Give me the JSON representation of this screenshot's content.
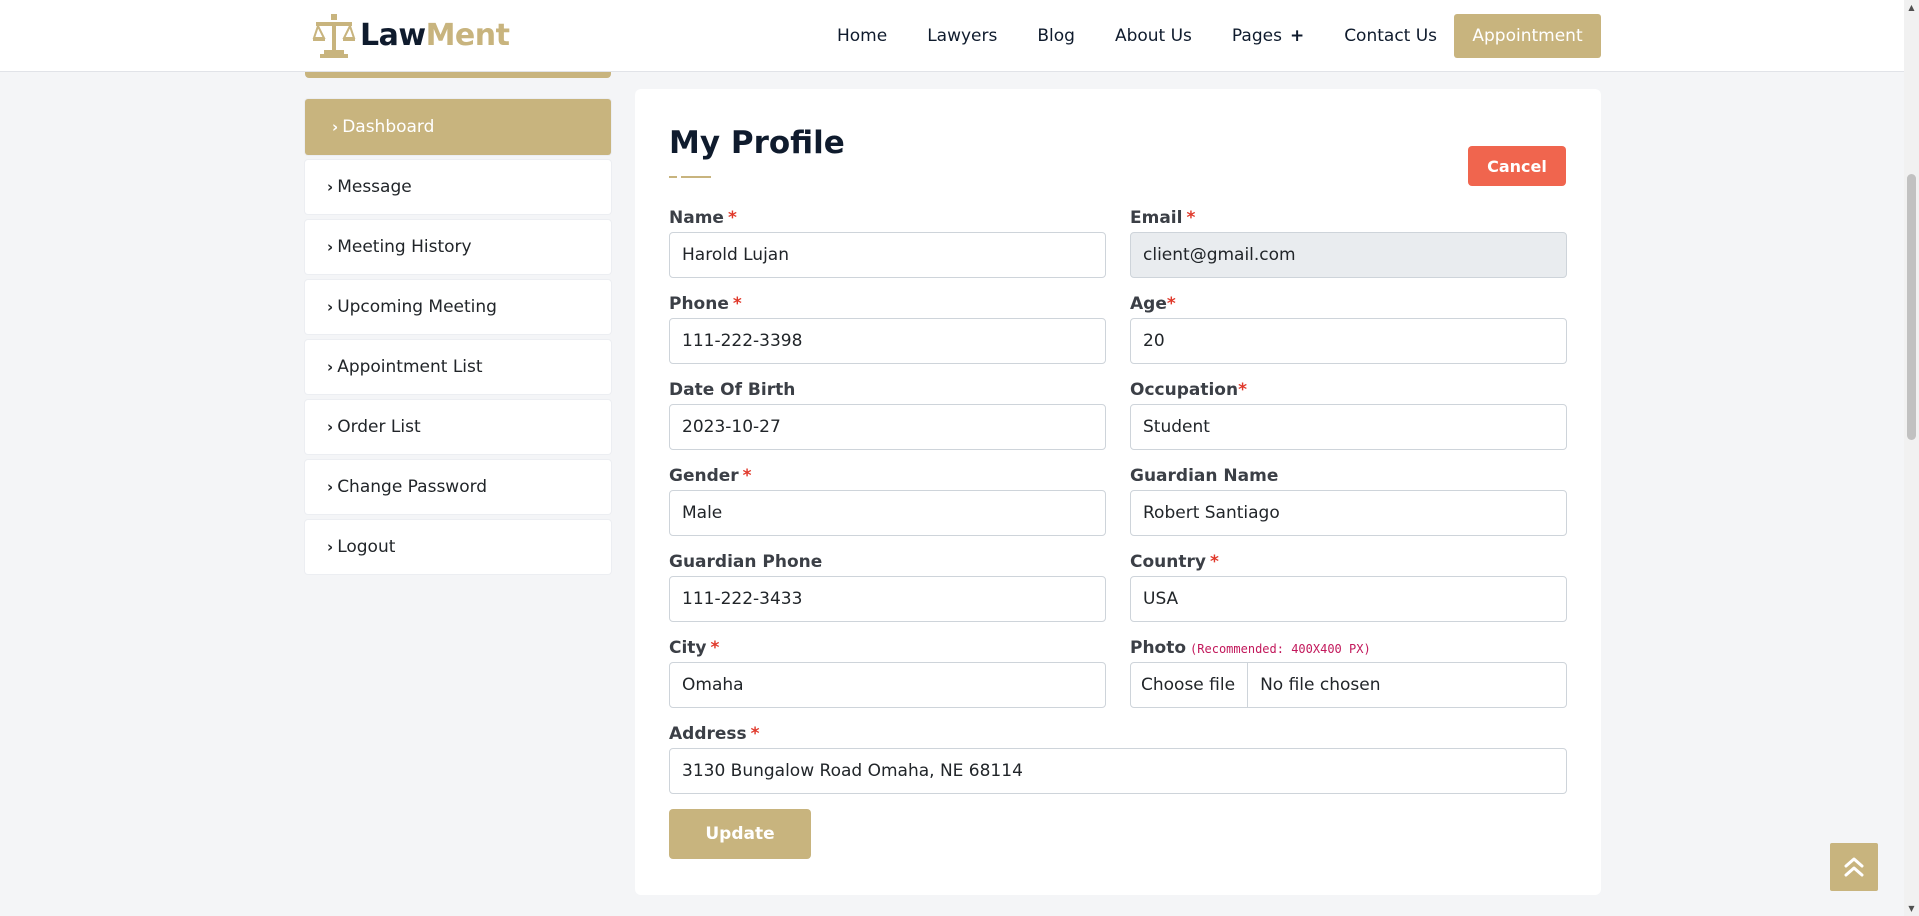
{
  "header": {
    "logo": {
      "part1": "Law",
      "part2": "Ment"
    },
    "nav": [
      {
        "label": "Home"
      },
      {
        "label": "Lawyers"
      },
      {
        "label": "Blog"
      },
      {
        "label": "About Us"
      },
      {
        "label": "Pages",
        "has_submenu": true,
        "submenu_icon": "+"
      },
      {
        "label": "Contact Us"
      }
    ],
    "appointment_label": "Appointment"
  },
  "sidebar": {
    "items": [
      {
        "label": "Dashboard",
        "active": true
      },
      {
        "label": "Message"
      },
      {
        "label": "Meeting History"
      },
      {
        "label": "Upcoming Meeting"
      },
      {
        "label": "Appointment List"
      },
      {
        "label": "Order List"
      },
      {
        "label": "Change Password"
      },
      {
        "label": "Logout"
      }
    ]
  },
  "profile": {
    "title": "My Profile",
    "cancel_label": "Cancel",
    "required_mark": "*",
    "fields": {
      "name": {
        "label": "Name",
        "value": "Harold Lujan"
      },
      "email": {
        "label": "Email",
        "value": "client@gmail.com",
        "disabled": true
      },
      "phone": {
        "label": "Phone",
        "value": "111-222-3398"
      },
      "age": {
        "label": "Age",
        "value": "20"
      },
      "dob": {
        "label": "Date Of Birth",
        "value": "2023-10-27"
      },
      "occupation": {
        "label": "Occupation",
        "value": "Student"
      },
      "gender": {
        "label": "Gender",
        "value": "Male"
      },
      "guardian_name": {
        "label": "Guardian Name",
        "value": "Robert Santiago"
      },
      "guardian_phone": {
        "label": "Guardian Phone",
        "value": "111-222-3433"
      },
      "country": {
        "label": "Country",
        "value": "USA"
      },
      "city": {
        "label": "City",
        "value": "Omaha"
      },
      "photo": {
        "label": "Photo",
        "hint": "(Recommended: 400X400 PX)",
        "button": "Choose file",
        "status": "No file chosen"
      },
      "address": {
        "label": "Address",
        "value": "3130 Bungalow Road Omaha, NE 68114"
      }
    },
    "update_label": "Update"
  },
  "colors": {
    "accent": "#c8b47e",
    "navy": "#0f1b2d",
    "cancel": "#f0654e",
    "required": "#e0392b",
    "hint": "#c2185b"
  },
  "icons": {
    "scroll_top": "double-chevron-up-icon",
    "sidebar_item": "chevron-right-icon"
  }
}
